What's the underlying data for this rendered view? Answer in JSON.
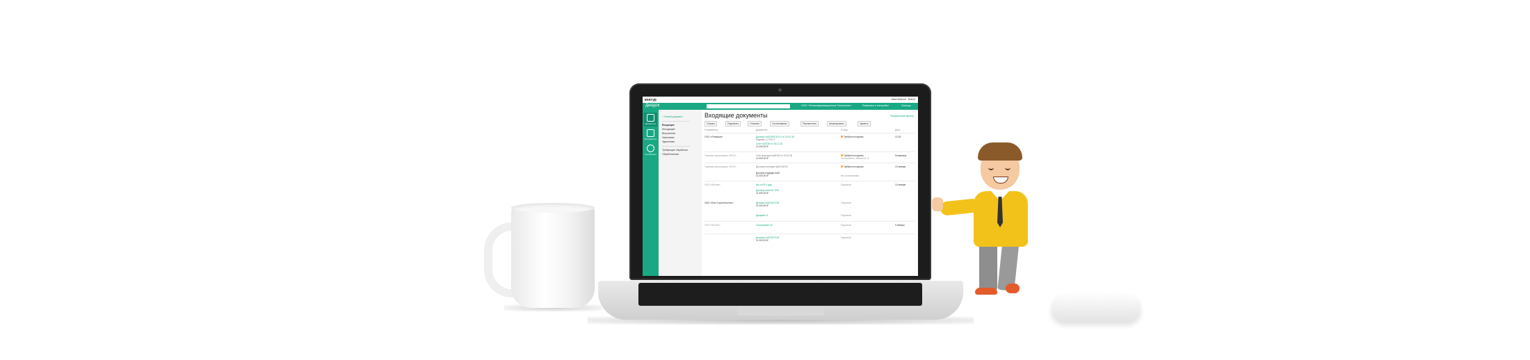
{
  "app": {
    "logo": "контур",
    "name": "Диадок",
    "user": "Иван Иванов",
    "logout": "Выйти",
    "org_selector": "ООО «Телекоммуникационные Технологии»",
    "settings": "Реквизиты и настройки",
    "help": "Помощь"
  },
  "sidebar": {
    "items": [
      {
        "label": "Документы",
        "icon": "document-icon",
        "active": true
      },
      {
        "label": "Контрагенты",
        "icon": "contacts-icon",
        "active": false
      },
      {
        "label": "Сообщения",
        "icon": "chat-icon",
        "active": false
      }
    ]
  },
  "nav": {
    "new_document": "+ Новый документ",
    "items": [
      "Входящие",
      "Исходящие",
      "Внутренние",
      "Черновики",
      "Удаленные"
    ],
    "extra": [
      "Требующие обработки",
      "Обработанные"
    ]
  },
  "content": {
    "title": "Входящие документы",
    "advanced_filter": "Расширенный фильтр",
    "toolbar": [
      "Скачать",
      "Подписать",
      "Отказать",
      "Согласование",
      "Переместить",
      "Аннулировать",
      "Удалить"
    ],
    "columns": [
      "Отправитель",
      "Документы",
      "Статус",
      "Дата"
    ],
    "rows": [
      {
        "sender": "ООО «Ромашка»",
        "doc": "Договор №52/18/СФ-К-2 от 18.12.18",
        "doc_sub": "Подпись: 17.03.17",
        "doc2": "Счёт №52/18 от 18.12.18",
        "amount": "11 000,00 ₽",
        "status": "Требуется подпись",
        "status_sub": "",
        "date": "12.03"
      },
      {
        "sender": "Торговая организация «ФСО»",
        "doc": "Счёт-фактура №52/18 от 10.02.18",
        "doc_sub": "",
        "doc2": "",
        "amount": "11 000,00 ₽",
        "status": "Требуется подпись",
        "status_sub": "Согласовано: Иванов И. И.",
        "date": "Позавчера"
      },
      {
        "sender": "Торговая организация «ФСО»",
        "doc": "Договор поставки №52/18/СФ",
        "doc_sub": "",
        "doc2": "Договор подряда №52",
        "amount": "11 000,00 ₽",
        "status": "Требуется подпись",
        "status_sub": "На согласовании",
        "date": "10 января"
      },
      {
        "sender": "ООО «Ветчик»",
        "doc": "Акт №75 4 рдр",
        "doc_sub": "",
        "doc2": "Договор №52/18 ТОФ",
        "amount": "11 000,00 ₽",
        "status": "Подписан",
        "status_sub": "",
        "date": "10 января"
      },
      {
        "sender": "ОАО «Нов.Строительство»",
        "doc": "Договор №52/18 РОФ",
        "doc_sub": "",
        "doc2": "",
        "amount": "11 000,00 ₽",
        "status": "Подписан",
        "status_sub": "",
        "date": ""
      },
      {
        "sender": "",
        "doc": "Документ 8",
        "doc_sub": "",
        "doc2": "",
        "amount": "",
        "status": "Подписан",
        "status_sub": "",
        "date": ""
      },
      {
        "sender": "ООО «Ветчик»",
        "doc": "Соглашение 44",
        "doc_sub": "",
        "doc2": "",
        "amount": "",
        "status": "Подписан",
        "status_sub": "",
        "date": "9 января"
      },
      {
        "sender": "",
        "doc": "Договор №52/18 РОФ",
        "doc_sub": "",
        "doc2": "",
        "amount": "11 000,00 ₽",
        "status": "Подписан",
        "status_sub": "",
        "date": ""
      }
    ]
  }
}
